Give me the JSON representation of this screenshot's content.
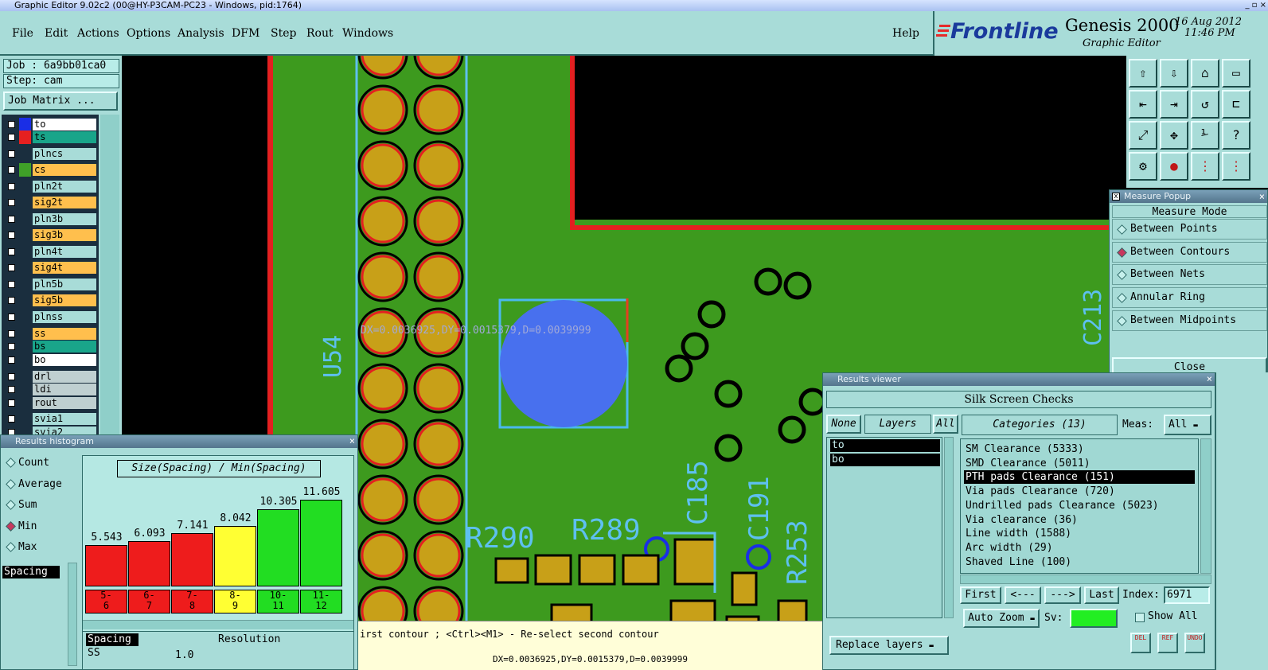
{
  "window": {
    "title": "Graphic Editor 9.02c2 (00@HY-P3CAM-PC23 - Windows, pid:1764)"
  },
  "menu": {
    "items": [
      "File",
      "Edit",
      "Actions",
      "Options",
      "Analysis",
      "DFM",
      "Step",
      "Rout",
      "Windows"
    ],
    "help": "Help"
  },
  "brand": {
    "logo": "Frontline",
    "product": "Genesis 2000",
    "subtitle": "Graphic Editor",
    "date": "16 Aug 2012",
    "time": "11:46 PM"
  },
  "job": {
    "job_label": "Job : 6a9bb01ca0",
    "step_label": "Step: cam",
    "matrix_button": "Job Matrix ..."
  },
  "layers": [
    {
      "name": "to",
      "color": "#ffffff",
      "swatch": "#1a2ee6",
      "state": "work"
    },
    {
      "name": "ts",
      "color": "#19a58a",
      "swatch": "#e62020",
      "state": "display"
    },
    {
      "name": "plncs",
      "color": "#a8dcd8",
      "swatch": "#1a2e3e"
    },
    {
      "name": "cs",
      "color": "#ffbf4d",
      "swatch": "#3fa028"
    },
    {
      "name": "pln2t",
      "color": "#a8dcd8",
      "swatch": "#1a2e3e"
    },
    {
      "name": "sig2t",
      "color": "#ffbf4d",
      "swatch": "#1a2e3e"
    },
    {
      "name": "pln3b",
      "color": "#a8dcd8",
      "swatch": "#1a2e3e"
    },
    {
      "name": "sig3b",
      "color": "#ffbf4d",
      "swatch": "#1a2e3e"
    },
    {
      "name": "pln4t",
      "color": "#a8dcd8",
      "swatch": "#1a2e3e"
    },
    {
      "name": "sig4t",
      "color": "#ffbf4d",
      "swatch": "#1a2e3e"
    },
    {
      "name": "pln5b",
      "color": "#a8dcd8",
      "swatch": "#1a2e3e"
    },
    {
      "name": "sig5b",
      "color": "#ffbf4d",
      "swatch": "#1a2e3e"
    },
    {
      "name": "plnss",
      "color": "#a8dcd8",
      "swatch": "#1a2e3e"
    },
    {
      "name": "ss",
      "color": "#ffbf4d",
      "swatch": "#1a2e3e"
    },
    {
      "name": "bs",
      "color": "#19a58a",
      "swatch": "#1a2e3e"
    },
    {
      "name": "bo",
      "color": "#ffffff",
      "swatch": "#1a2e3e",
      "state": "work"
    },
    {
      "name": "drl",
      "color": "#bfcfd0",
      "swatch": "#1a2e3e"
    },
    {
      "name": "ldi",
      "color": "#bfcfd0",
      "swatch": "#1a2e3e"
    },
    {
      "name": "rout",
      "color": "#bfcfd0",
      "swatch": "#1a2e3e"
    },
    {
      "name": "svia1",
      "color": "#a8dcd8",
      "swatch": "#1a2e3e"
    },
    {
      "name": "svia2",
      "color": "#a8dcd8",
      "swatch": "#1a2e3e"
    }
  ],
  "canvas": {
    "measure_text": "DX=0.0036925,DY=0.0015379,D=0.0039999",
    "refdes": [
      "U54",
      "C213",
      "C185",
      "C191",
      "R253",
      "R290",
      "R289"
    ],
    "status_prompt": "irst contour ; <Ctrl><M1> - Re-select second contour",
    "status_readout": "DX=0.0036925,DY=0.0015379,D=0.0039999"
  },
  "measure_popup": {
    "title": "Measure Popup",
    "mode_label": "Measure Mode",
    "options": [
      "Between Points",
      "Between Contours",
      "Between Nets",
      "Annular Ring",
      "Between Midpoints"
    ],
    "selected": "Between Contours",
    "close_label": "Close"
  },
  "histogram": {
    "title": "Results histogram",
    "stat_options": [
      "Count",
      "Average",
      "Sum",
      "Min",
      "Max"
    ],
    "selected_stat": "Min",
    "chart_title": "Size(Spacing) / Min(Spacing)",
    "list_selected": "Spacing",
    "list_items": [
      "Spacing",
      "SS"
    ],
    "resolution_label": "Resolution",
    "resolution_value": "1.0"
  },
  "chart_data": {
    "type": "bar",
    "title": "Size(Spacing) / Min(Spacing)",
    "categories": [
      "5-6",
      "6-7",
      "7-8",
      "8-9",
      "10-11",
      "11-12"
    ],
    "category_tops": [
      "5-",
      "6-",
      "7-",
      "8-",
      "10-",
      "11-"
    ],
    "category_bottoms": [
      "6",
      "7",
      "8",
      "9",
      "11",
      "12"
    ],
    "values": [
      5.543,
      6.093,
      7.141,
      8.042,
      10.305,
      11.605
    ],
    "value_labels": [
      "5.543",
      "6.093",
      "7.141",
      "8.042",
      "10.305",
      "11.605"
    ],
    "colors": [
      "#ee1c1c",
      "#ee1c1c",
      "#ee1c1c",
      "#ffff33",
      "#22dd22",
      "#22dd22"
    ],
    "ylim": [
      0,
      12.3
    ],
    "grid": false,
    "legend": "none"
  },
  "results": {
    "title": "Results viewer",
    "header": "Silk Screen Checks",
    "none_btn": "None",
    "layers_label": "Layers",
    "all_btn": "All",
    "categories_label": "Categories (13)",
    "meas_label": "Meas:",
    "meas_value": "All",
    "layer_list": [
      "to",
      "bo"
    ],
    "categories": [
      "SM Clearance (5333)",
      "SMD Clearance (5011)",
      "PTH pads Clearance (151)",
      "Via pads Clearance (720)",
      "Undrilled pads Clearance (5023)",
      "Via clearance (36)",
      "Line width (1588)",
      "Arc width (29)",
      "Shaved Line (100)"
    ],
    "selected_category": "PTH pads Clearance (151)",
    "nav": {
      "first": "First",
      "prev": "<---",
      "next": "--->",
      "last": "Last",
      "index_label": "Index:",
      "index_value": "6971"
    },
    "auto_zoom": "Auto Zoom",
    "sv_label": "Sv:",
    "show_all": "Show All",
    "replace_layers": "Replace layers",
    "tool_labels": [
      "DEL",
      "REF",
      "UNDO"
    ]
  }
}
